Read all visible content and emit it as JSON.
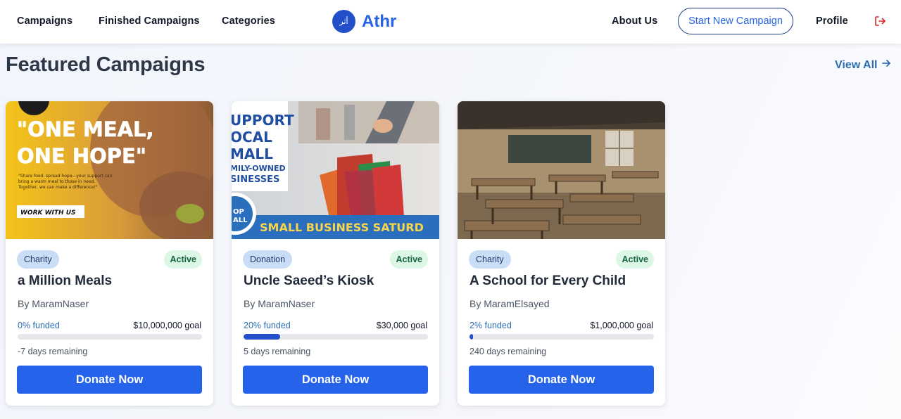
{
  "nav": {
    "campaigns": "Campaigns",
    "finished_campaigns": "Finished Campaigns",
    "categories": "Categories",
    "brand_name": "Athr",
    "brand_logo_text": "أثر",
    "about_us": "About Us",
    "start_new_campaign": "Start New Campaign",
    "profile": "Profile",
    "logout_icon": "logout-icon"
  },
  "section": {
    "title": "Featured Campaigns",
    "view_all": "View All"
  },
  "cards": [
    {
      "image_text": {
        "headline_1": "\"ONE MEAL,",
        "headline_2": "ONE HOPE\"",
        "body_1": "\"Share food, spread hope—your support can",
        "body_2": "bring a warm meal to those in need.",
        "body_3": "Together, we can make a difference!\"",
        "tag": "WORK WITH US"
      },
      "category": "Charity",
      "status": "Active",
      "title": "a Million Meals",
      "author": "By MaramNaser",
      "funded": "0% funded",
      "funded_fraction": 0.0,
      "goal": "$10,000,000 goal",
      "days": "-7 days remaining",
      "donate": "Donate Now"
    },
    {
      "image_text": {
        "line_1": "UPPORT",
        "line_2": "OCAL",
        "line_3": "MALL",
        "line_4": "MILY-OWNED",
        "line_5": "SINESSES",
        "banner": "SMALL BUSINESS SATURD",
        "seal_1": "OP",
        "seal_2": "ALL"
      },
      "category": "Donation",
      "status": "Active",
      "title": "Uncle Saeed’s Kiosk",
      "author": "By MaramNaser",
      "funded": "20% funded",
      "funded_fraction": 0.2,
      "goal": "$30,000 goal",
      "days": "5 days remaining",
      "donate": "Donate Now"
    },
    {
      "category": "Charity",
      "status": "Active",
      "title": "A School for Every Child",
      "author": "By MaramElsayed",
      "funded": "2% funded",
      "funded_fraction": 0.02,
      "goal": "$1,000,000 goal",
      "days": "240 days remaining",
      "donate": "Donate Now"
    }
  ],
  "colors": {
    "brand": "#2563eb",
    "badge_category_bg": "#c9ddf7",
    "badge_active_bg": "#dcf7e6",
    "progress_fill": "#2350c9",
    "logout_icon": "#dc2626"
  }
}
